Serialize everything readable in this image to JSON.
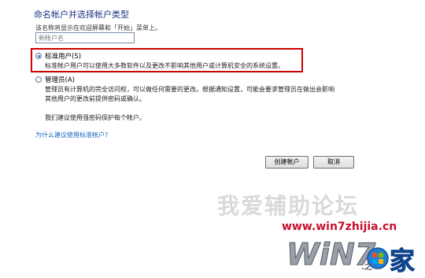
{
  "page": {
    "title": "命名帐户并选择帐户类型",
    "instruction": "该名称将显示在欢迎屏幕和「开始」菜单上。"
  },
  "name_field": {
    "placeholder": "新帐户名"
  },
  "standard_option": {
    "label": "标准用户(S)",
    "description": "标准帐户用户可以使用大多数软件以及更改不影响其他用户或计算机安全的系统设置。",
    "selected": true
  },
  "admin_option": {
    "label": "管理员(A)",
    "description_line1": "管理员有计算机的完全访问权，可以做任何需要的更改。根据通知设置，可能会要求管理员在做出会影响",
    "description_line2": "其他用户的更改前提供密码或确认。",
    "selected": false
  },
  "recommendation": "我们建议使用强密码保护每个帐户。",
  "help_link": "为什么建议使用标准帐户?",
  "buttons": {
    "create": "创建帐户",
    "cancel": "取消"
  },
  "watermark": {
    "slogan": "我爱辅助论坛",
    "url": "www.win7zhijia.cn",
    "logo_text": "WiN7.之家"
  },
  "colors": {
    "highlight": "#cc0000",
    "title": "#1e3287",
    "link": "#1566c0"
  }
}
